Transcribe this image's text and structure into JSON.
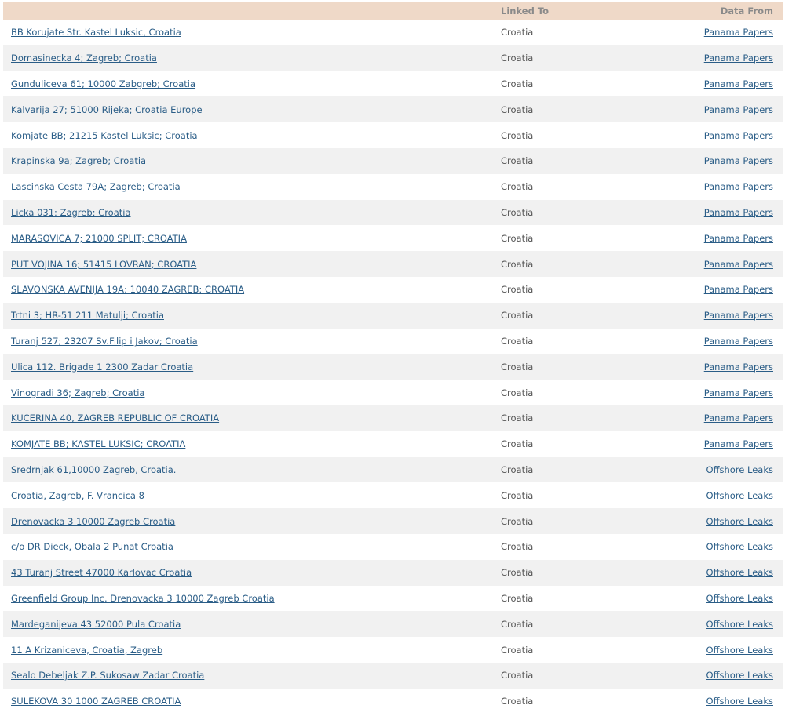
{
  "table": {
    "headers": {
      "address": "",
      "linked_to": "Linked To",
      "data_from": "Data From"
    },
    "rows": [
      {
        "address": "BB Korujate Str. Kastel Luksic, Croatia",
        "linked_to": "Croatia",
        "data_from": "Panama Papers"
      },
      {
        "address": "Domasinecka 4; Zagreb; Croatia",
        "linked_to": "Croatia",
        "data_from": "Panama Papers"
      },
      {
        "address": "Gunduliceva 61; 10000 Zabgreb; Croatia",
        "linked_to": "Croatia",
        "data_from": "Panama Papers"
      },
      {
        "address": "Kalvarija 27; 51000 Rijeka; Croatia Europe",
        "linked_to": "Croatia",
        "data_from": "Panama Papers"
      },
      {
        "address": "Komjate BB; 21215 Kastel Luksic; Croatia",
        "linked_to": "Croatia",
        "data_from": "Panama Papers"
      },
      {
        "address": "Krapinska 9a; Zagreb; Croatia",
        "linked_to": "Croatia",
        "data_from": "Panama Papers"
      },
      {
        "address": "Lascinska Cesta 79A; Zagreb; Croatia",
        "linked_to": "Croatia",
        "data_from": "Panama Papers"
      },
      {
        "address": "Licka 031; Zagreb; Croatia",
        "linked_to": "Croatia",
        "data_from": "Panama Papers"
      },
      {
        "address": "MARASOVICA 7; 21000 SPLIT; CROATIA",
        "linked_to": "Croatia",
        "data_from": "Panama Papers"
      },
      {
        "address": "PUT VOJINA 16; 51415 LOVRAN; CROATIA",
        "linked_to": "Croatia",
        "data_from": "Panama Papers"
      },
      {
        "address": "SLAVONSKA AVENIJA 19A; 10040 ZAGREB; CROATIA",
        "linked_to": "Croatia",
        "data_from": "Panama Papers"
      },
      {
        "address": "Trtni 3; HR-51 211 Matulji; Croatia",
        "linked_to": "Croatia",
        "data_from": "Panama Papers"
      },
      {
        "address": "Turanj 527; 23207 Sv.Filip i Jakov; Croatia",
        "linked_to": "Croatia",
        "data_from": "Panama Papers"
      },
      {
        "address": "Ulica 112. Brigade 1 2300 Zadar Croatia",
        "linked_to": "Croatia",
        "data_from": "Panama Papers"
      },
      {
        "address": "Vinogradi 36; Zagreb; Croatia",
        "linked_to": "Croatia",
        "data_from": "Panama Papers"
      },
      {
        "address": "KUCERINA 40, ZAGREB REPUBLIC OF CROATIA",
        "linked_to": "Croatia",
        "data_from": "Panama Papers"
      },
      {
        "address": "KOMJATE BB; KASTEL LUKSIC; CROATIA",
        "linked_to": "Croatia",
        "data_from": "Panama Papers"
      },
      {
        "address": "Sredrnjak 61,10000 Zagreb, Croatia.",
        "linked_to": "Croatia",
        "data_from": "Offshore Leaks"
      },
      {
        "address": "Croatia, Zagreb, F. Vrancica 8",
        "linked_to": "Croatia",
        "data_from": "Offshore Leaks"
      },
      {
        "address": "Drenovacka 3 10000 Zagreb Croatia",
        "linked_to": "Croatia",
        "data_from": "Offshore Leaks"
      },
      {
        "address": "c/o DR Dieck, Obala 2 Punat Croatia",
        "linked_to": "Croatia",
        "data_from": "Offshore Leaks"
      },
      {
        "address": "43 Turanj Street 47000 Karlovac Croatia",
        "linked_to": "Croatia",
        "data_from": "Offshore Leaks"
      },
      {
        "address": "Greenfield Group Inc. Drenovacka 3 10000 Zagreb Croatia",
        "linked_to": "Croatia",
        "data_from": "Offshore Leaks"
      },
      {
        "address": "Mardeganijeva 43 52000 Pula Croatia",
        "linked_to": "Croatia",
        "data_from": "Offshore Leaks"
      },
      {
        "address": "11 A Krizaniceva, Croatia, Zagreb",
        "linked_to": "Croatia",
        "data_from": "Offshore Leaks"
      },
      {
        "address": "Sealo Debeljak Z.P. Sukosaw Zadar Croatia",
        "linked_to": "Croatia",
        "data_from": "Offshore Leaks"
      },
      {
        "address": "SULEKOVA 30 1000 ZAGREB CROATIA",
        "linked_to": "Croatia",
        "data_from": "Offshore Leaks"
      }
    ]
  },
  "colors": {
    "header_bg": "#efd9c8",
    "alt_row_bg": "#f1f1f1",
    "link": "#2a5d87"
  }
}
